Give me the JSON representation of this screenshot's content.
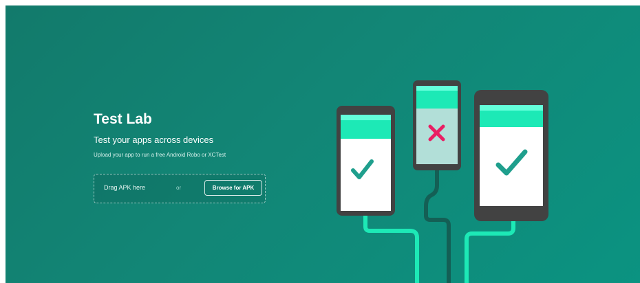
{
  "hero": {
    "title": "Test Lab",
    "subtitle": "Test your apps across devices",
    "description": "Upload your app to run a free Android Robo or XCTest"
  },
  "upload": {
    "drag_label": "Drag APK here",
    "or_label": "or",
    "browse_button": "Browse for APK"
  },
  "illustration": {
    "devices": [
      {
        "name": "left-phone",
        "status": "pass",
        "icon": "check-icon"
      },
      {
        "name": "center-phone",
        "status": "fail",
        "icon": "x-icon"
      },
      {
        "name": "right-tablet",
        "status": "pass",
        "icon": "check-icon"
      }
    ]
  },
  "colors": {
    "background": "#128676",
    "accent": "#1de9b6",
    "device_frame": "#424242",
    "pass_check": "#1f9f8d",
    "fail_x": "#e91e63"
  }
}
